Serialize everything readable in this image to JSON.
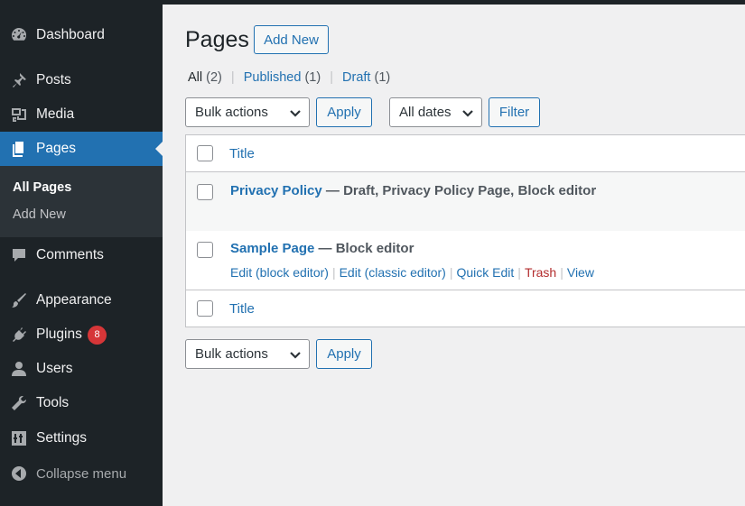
{
  "sidebar": {
    "items": [
      {
        "label": "Dashboard",
        "icon": "dashboard-icon"
      },
      {
        "label": "Posts",
        "icon": "pin-icon"
      },
      {
        "label": "Media",
        "icon": "media-icon"
      },
      {
        "label": "Pages",
        "icon": "pages-icon"
      },
      {
        "label": "Comments",
        "icon": "comment-icon"
      },
      {
        "label": "Appearance",
        "icon": "brush-icon"
      },
      {
        "label": "Plugins",
        "icon": "plug-icon"
      },
      {
        "label": "Users",
        "icon": "user-icon"
      },
      {
        "label": "Tools",
        "icon": "wrench-icon"
      },
      {
        "label": "Settings",
        "icon": "sliders-icon"
      },
      {
        "label": "Collapse menu",
        "icon": "collapse-icon"
      }
    ],
    "plugins_badge": "8",
    "submenu": [
      {
        "label": "All Pages"
      },
      {
        "label": "Add New"
      }
    ],
    "colors": {
      "background": "#1d2327",
      "current": "#2271b1",
      "badge": "#d63638"
    }
  },
  "main": {
    "title": "Pages",
    "add_new": "Add New",
    "views": {
      "all_label": "All",
      "all_count": "(2)",
      "published_label": "Published",
      "published_count": "(1)",
      "draft_label": "Draft",
      "draft_count": "(1)",
      "separator": "|"
    },
    "top_bulk_select": "Bulk actions",
    "top_apply": "Apply",
    "dates_select": "All dates",
    "filter": "Filter",
    "table": {
      "header_title": "Title",
      "footer_title": "Title",
      "rows": [
        {
          "title": "Privacy Policy",
          "state": " — Draft, Privacy Policy Page, Block editor"
        },
        {
          "title": "Sample Page",
          "state": " — Block editor",
          "actions": {
            "edit_block": "Edit (block editor)",
            "edit_classic": "Edit (classic editor)",
            "quick_edit": "Quick Edit",
            "trash": "Trash",
            "view": "View",
            "separator": "|"
          }
        }
      ]
    },
    "bottom_bulk_select": "Bulk actions",
    "bottom_apply": "Apply",
    "colors": {
      "link": "#2271b1",
      "trash": "#b32d2e"
    }
  }
}
